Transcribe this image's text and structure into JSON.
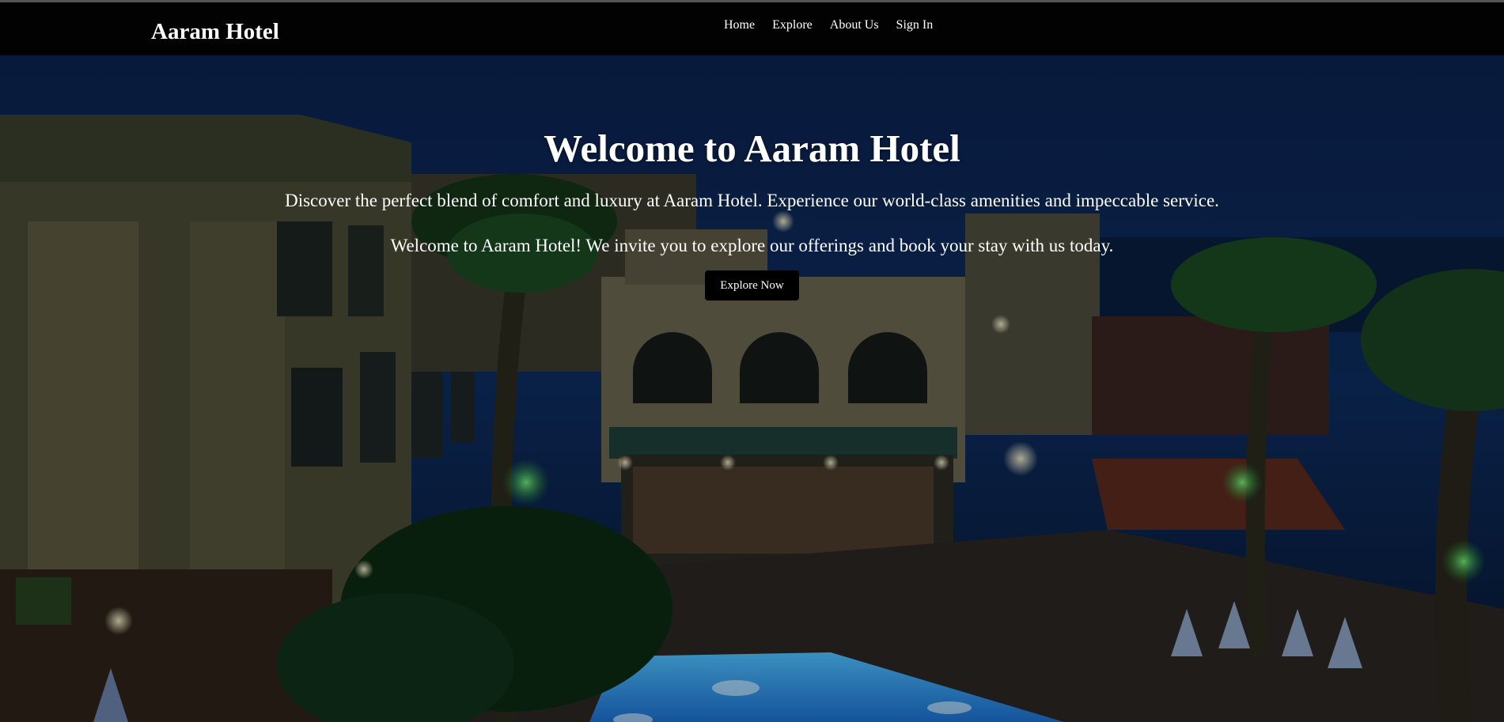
{
  "navbar": {
    "brand": "Aaram Hotel",
    "links": [
      {
        "label": "Home"
      },
      {
        "label": "Explore"
      },
      {
        "label": "About Us"
      },
      {
        "label": "Sign In"
      }
    ]
  },
  "hero": {
    "title": "Welcome to Aaram Hotel",
    "subtitle": "Discover the perfect blend of comfort and luxury at Aaram Hotel. Experience our world-class amenities and impeccable service.",
    "subtitle2": "Welcome to Aaram Hotel! We invite you to explore our offerings and book your stay with us today.",
    "cta_label": "Explore Now",
    "image": "hotel-night-pool-photo"
  },
  "colors": {
    "navbar_bg": "#020202",
    "text": "#ffffff",
    "button_bg": "#000000",
    "sky": "#0d2a55",
    "pool": "#2aa6ff"
  }
}
